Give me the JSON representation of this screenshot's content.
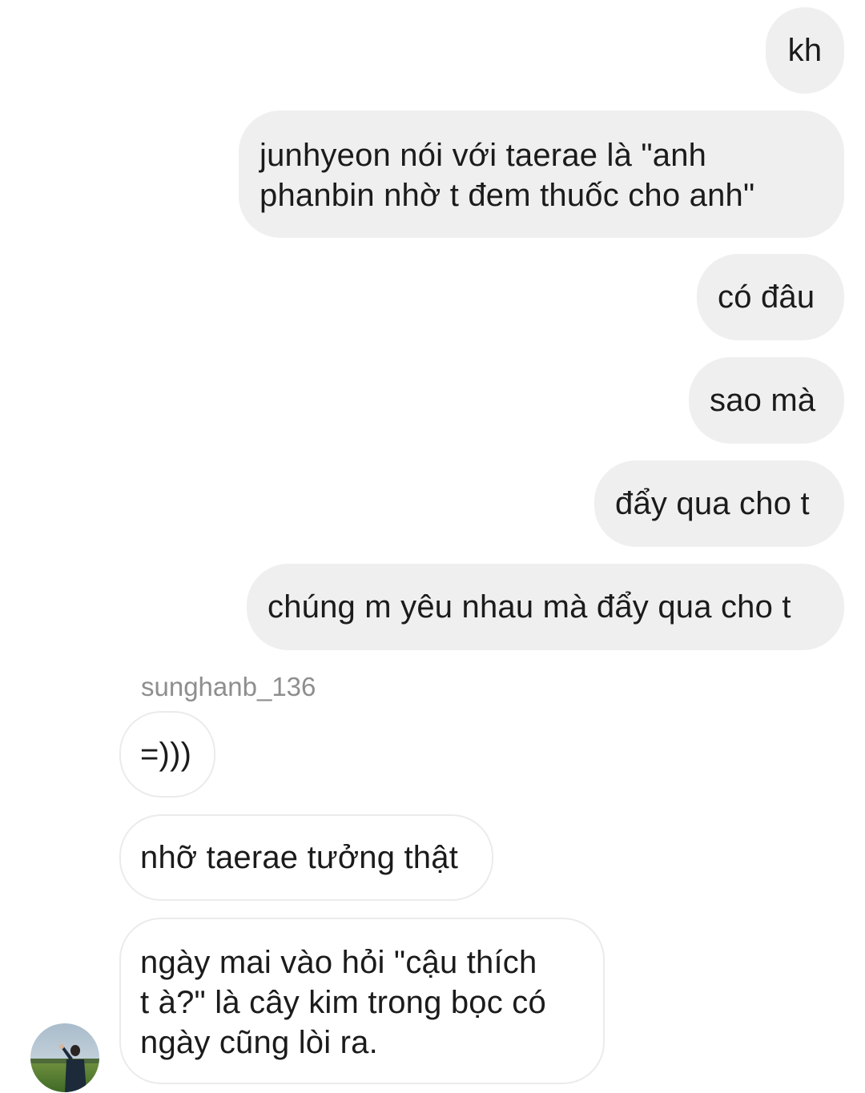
{
  "conversation": {
    "sent_messages": [
      "kh",
      "junhyeon nói với taerae là \"anh\nphanbin nhờ t đem thuốc cho anh\"",
      "có đâu",
      "sao mà",
      "đẩy qua cho t",
      "chúng m yêu nhau mà đẩy qua cho t"
    ],
    "other_user": {
      "username": "sunghanb_136",
      "avatar_icon": "profile-photo-person-in-field"
    },
    "received_messages": [
      "=)))",
      "nhỡ taerae tưởng thật",
      "ngày mai vào hỏi \"cậu thích\nt à?\" là cây kim trong bọc có\nngày cũng lòi ra."
    ]
  },
  "colors": {
    "sent_bubble": "#efefef",
    "received_bubble_border": "#ebebeb",
    "username_text": "#8e8e8e",
    "message_text": "#1b1b1b"
  }
}
